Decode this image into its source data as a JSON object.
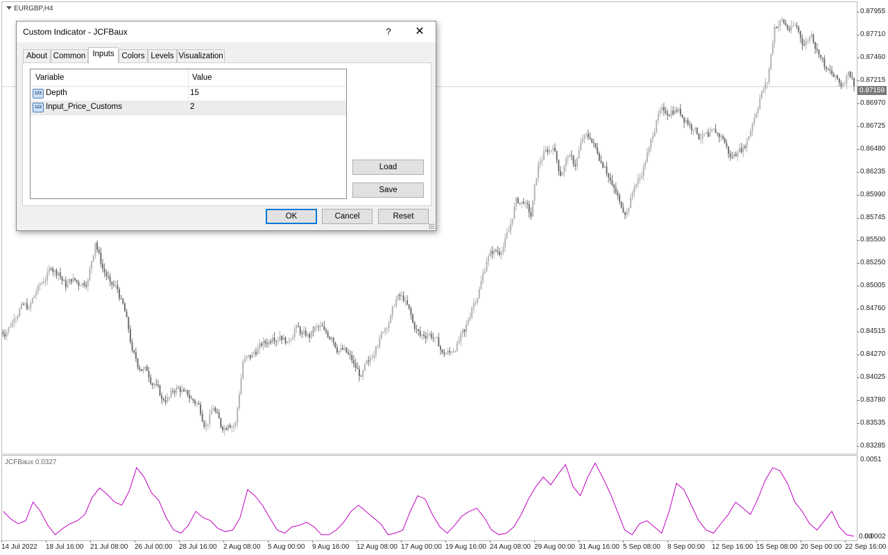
{
  "chart": {
    "symbol_label": "EURGBP,H4",
    "current_price": "0.87159",
    "price_axis": [
      "0.87955",
      "0.87710",
      "0.87460",
      "0.87215",
      "0.86970",
      "0.86725",
      "0.86480",
      "0.86235",
      "0.85990",
      "0.85745",
      "0.85500",
      "0.85250",
      "0.85005",
      "0.84760",
      "0.84515",
      "0.84270",
      "0.84025",
      "0.83780",
      "0.83535",
      "0.83285"
    ],
    "time_axis": [
      "14 Jul 2022",
      "18 Jul 16:00",
      "21 Jul 08:00",
      "26 Jul 00:00",
      "28 Jul 16:00",
      "2 Aug 08:00",
      "5 Aug 00:00",
      "9 Aug 16:00",
      "12 Aug 08:00",
      "17 Aug 00:00",
      "19 Aug 16:00",
      "24 Aug 08:00",
      "29 Aug 00:00",
      "31 Aug 16:00",
      "5 Sep 08:00",
      "8 Sep 00:00",
      "12 Sep 16:00",
      "15 Sep 08:00",
      "20 Sep 00:00",
      "22 Sep 16:00"
    ],
    "price_closes": [
      0.8452,
      0.8466,
      0.8482,
      0.8478,
      0.8495,
      0.8506,
      0.852,
      0.8516,
      0.85,
      0.851,
      0.8502,
      0.8508,
      0.8548,
      0.852,
      0.8506,
      0.8498,
      0.8474,
      0.8432,
      0.8412,
      0.841,
      0.8396,
      0.838,
      0.8382,
      0.8392,
      0.8388,
      0.838,
      0.8374,
      0.8352,
      0.837,
      0.835,
      0.8352,
      0.8354,
      0.842,
      0.8424,
      0.8434,
      0.844,
      0.8446,
      0.8448,
      0.8442,
      0.8456,
      0.845,
      0.8446,
      0.8458,
      0.8454,
      0.8446,
      0.8432,
      0.843,
      0.8418,
      0.8404,
      0.842,
      0.8436,
      0.8452,
      0.847,
      0.8492,
      0.8486,
      0.8462,
      0.8448,
      0.845,
      0.8446,
      0.843,
      0.843,
      0.844,
      0.8452,
      0.8478,
      0.8498,
      0.8528,
      0.854,
      0.8538,
      0.856,
      0.8596,
      0.859,
      0.8576,
      0.8632,
      0.8648,
      0.865,
      0.862,
      0.864,
      0.863,
      0.866,
      0.866,
      0.8644,
      0.863,
      0.861,
      0.8592,
      0.8582,
      0.8608,
      0.862,
      0.865,
      0.868,
      0.869,
      0.869,
      0.8692,
      0.868,
      0.867,
      0.866,
      0.8662,
      0.8666,
      0.866,
      0.864,
      0.8645,
      0.865,
      0.8676,
      0.8704,
      0.872,
      0.878,
      0.8788,
      0.8776,
      0.878,
      0.876,
      0.8772,
      0.875,
      0.8735,
      0.8726,
      0.8716,
      0.8732,
      0.8716
    ],
    "indicator_values": [
      0.0018,
      0.0013,
      0.001,
      0.0012,
      0.0024,
      0.0018,
      0.0009,
      0.0003,
      0.0007,
      0.001,
      0.0012,
      0.0016,
      0.0027,
      0.0033,
      0.0029,
      0.0024,
      0.0022,
      0.0031,
      0.0046,
      0.004,
      0.003,
      0.0025,
      0.0014,
      0.0006,
      0.0004,
      0.0009,
      0.0018,
      0.0014,
      0.0012,
      0.0007,
      0.0005,
      0.0006,
      0.0014,
      0.0032,
      0.0028,
      0.0022,
      0.0014,
      0.0006,
      0.0004,
      0.0008,
      0.0009,
      0.0011,
      0.0008,
      0.0003,
      0.0003,
      0.0006,
      0.0011,
      0.0018,
      0.0022,
      0.0018,
      0.0014,
      0.001,
      0.0003,
      0.0004,
      0.0006,
      0.0018,
      0.0028,
      0.0026,
      0.0016,
      0.0008,
      0.0004,
      0.0009,
      0.0015,
      0.0018,
      0.002,
      0.0014,
      0.0006,
      0.0003,
      0.0004,
      0.0008,
      0.0016,
      0.0026,
      0.0034,
      0.004,
      0.0035,
      0.0042,
      0.0048,
      0.0034,
      0.0028,
      0.004,
      0.0049,
      0.004,
      0.003,
      0.0018,
      0.0006,
      0.0003,
      0.001,
      0.0012,
      0.0008,
      0.0004,
      0.0018,
      0.0036,
      0.0032,
      0.0022,
      0.0012,
      0.0006,
      0.0004,
      0.001,
      0.0016,
      0.0024,
      0.002,
      0.0016,
      0.0026,
      0.0038,
      0.0046,
      0.0044,
      0.0036,
      0.0024,
      0.0018,
      0.001,
      0.0006,
      0.0012,
      0.0018,
      0.0008,
      0.0003,
      0.0002
    ],
    "indicator_label": "JCFBaux 0.0327",
    "indicator_axis_top": "0.0051",
    "indicator_axis_bottom": "0.0002",
    "indicator_axis_bottom_overlap": "0.00",
    "colors": {
      "candle_up": "#b3b3b3",
      "candle_down": "#6e6e6e",
      "indicator_line": "#c000c0",
      "current_price_bg": "#7a7a7a"
    }
  },
  "dialog": {
    "title": "Custom Indicator - JCFBaux",
    "help_label": "?",
    "close_label": "✕",
    "tabs": [
      "About",
      "Common",
      "Inputs",
      "Colors",
      "Levels",
      "Visualization"
    ],
    "active_tab": "Inputs",
    "grid": {
      "headers": [
        "Variable",
        "Value"
      ],
      "rows": [
        {
          "icon": "123",
          "variable": "Depth",
          "value": "15"
        },
        {
          "icon": "123",
          "variable": "Input_Price_Customs",
          "value": "2"
        }
      ]
    },
    "load_label": "Load",
    "save_label": "Save",
    "ok_label": "OK",
    "cancel_label": "Cancel",
    "reset_label": "Reset"
  }
}
